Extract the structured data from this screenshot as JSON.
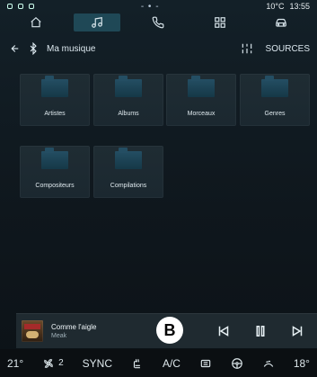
{
  "status": {
    "center": "- • -",
    "temp": "10°C",
    "time": "13:55"
  },
  "tabs": [
    {
      "icon": "home-icon",
      "active": false
    },
    {
      "icon": "music-icon",
      "active": true
    },
    {
      "icon": "phone-icon",
      "active": false
    },
    {
      "icon": "apps-icon",
      "active": false
    },
    {
      "icon": "car-icon",
      "active": false
    }
  ],
  "header": {
    "title": "Ma musique",
    "sources_label": "SOURCES"
  },
  "tiles": [
    {
      "label": "Artistes"
    },
    {
      "label": "Albums"
    },
    {
      "label": "Morceaux"
    },
    {
      "label": "Genres"
    },
    {
      "label": "Compositeurs"
    },
    {
      "label": "Compilations"
    }
  ],
  "now_playing": {
    "title": "Comme l'aigle",
    "artist": "Meak",
    "marker": "B"
  },
  "bottom": {
    "left_temp": "21°",
    "fan": "2",
    "sync": "SYNC",
    "ac": "A/C",
    "right_temp": "18°"
  }
}
